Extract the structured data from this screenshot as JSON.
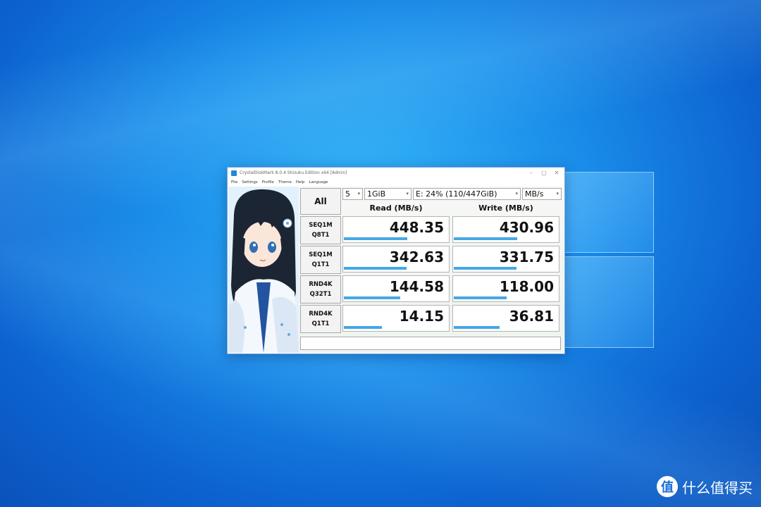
{
  "window": {
    "title": "CrystalDiskMark 8.0.4 Shizuku Edition x64 [Admin]",
    "controls": [
      "–",
      "▢",
      "✕"
    ]
  },
  "menu": [
    "File",
    "Settings",
    "Profile",
    "Theme",
    "Help",
    "Language"
  ],
  "toolbar": {
    "all_label": "All",
    "count": "5",
    "size": "1GiB",
    "drive": "E: 24% (110/447GiB)",
    "unit": "MB/s"
  },
  "headers": {
    "read": "Read (MB/s)",
    "write": "Write (MB/s)"
  },
  "tests": [
    {
      "line1": "SEQ1M",
      "line2": "Q8T1",
      "read": "448.35",
      "write": "430.96",
      "read_fill": 0.6,
      "write_fill": 0.6
    },
    {
      "line1": "SEQ1M",
      "line2": "Q1T1",
      "read": "342.63",
      "write": "331.75",
      "read_fill": 0.59,
      "write_fill": 0.59
    },
    {
      "line1": "RND4K",
      "line2": "Q32T1",
      "read": "144.58",
      "write": "118.00",
      "read_fill": 0.53,
      "write_fill": 0.5
    },
    {
      "line1": "RND4K",
      "line2": "Q1T1",
      "read": "14.15",
      "write": "36.81",
      "read_fill": 0.36,
      "write_fill": 0.43
    }
  ],
  "watermark": {
    "icon": "值",
    "text": "什么值得买"
  },
  "colors": {
    "bar": "#45a7e4",
    "desktop_accent": "#1a8eea"
  }
}
